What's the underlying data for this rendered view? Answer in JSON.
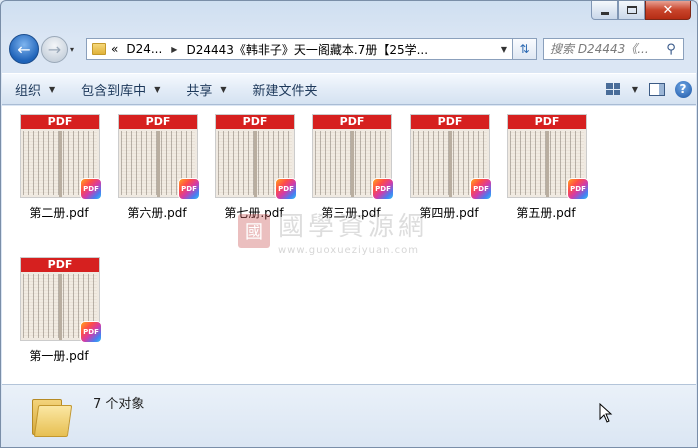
{
  "window": {
    "caption": {
      "minimize": "",
      "maximize": "",
      "close": "✕"
    }
  },
  "nav": {
    "back_icon": "back-arrow-icon",
    "forward_icon": "forward-arrow-icon",
    "recent_dropdown": "▾"
  },
  "address": {
    "overflow": "«",
    "crumbs": [
      "D24...",
      "D24443《韩非子》天一阁藏本.7册【25学..."
    ],
    "refresh_icon": "refresh-icon"
  },
  "search": {
    "placeholder": "搜索 D24443《..."
  },
  "toolbar": {
    "organize": "组织",
    "include_in_library": "包含到库中",
    "share": "共享",
    "new_folder": "新建文件夹"
  },
  "files": [
    {
      "name": "第二册.pdf",
      "badge": "PDF",
      "thumb_label": "PDF"
    },
    {
      "name": "第六册.pdf",
      "badge": "PDF",
      "thumb_label": "PDF"
    },
    {
      "name": "第七册.pdf",
      "badge": "PDF",
      "thumb_label": "PDF"
    },
    {
      "name": "第三册.pdf",
      "badge": "PDF",
      "thumb_label": "PDF"
    },
    {
      "name": "第四册.pdf",
      "badge": "PDF",
      "thumb_label": "PDF"
    },
    {
      "name": "第五册.pdf",
      "badge": "PDF",
      "thumb_label": "PDF"
    },
    {
      "name": "第一册.pdf",
      "badge": "PDF",
      "thumb_label": "PDF"
    }
  ],
  "watermark": {
    "seal": "國",
    "text": "國學資源網",
    "url": "www.guoxueziyuan.com"
  },
  "status": {
    "count": "7 个对象"
  },
  "colors": {
    "pdf_red": "#d6201f",
    "accent": "#1f63b9"
  }
}
